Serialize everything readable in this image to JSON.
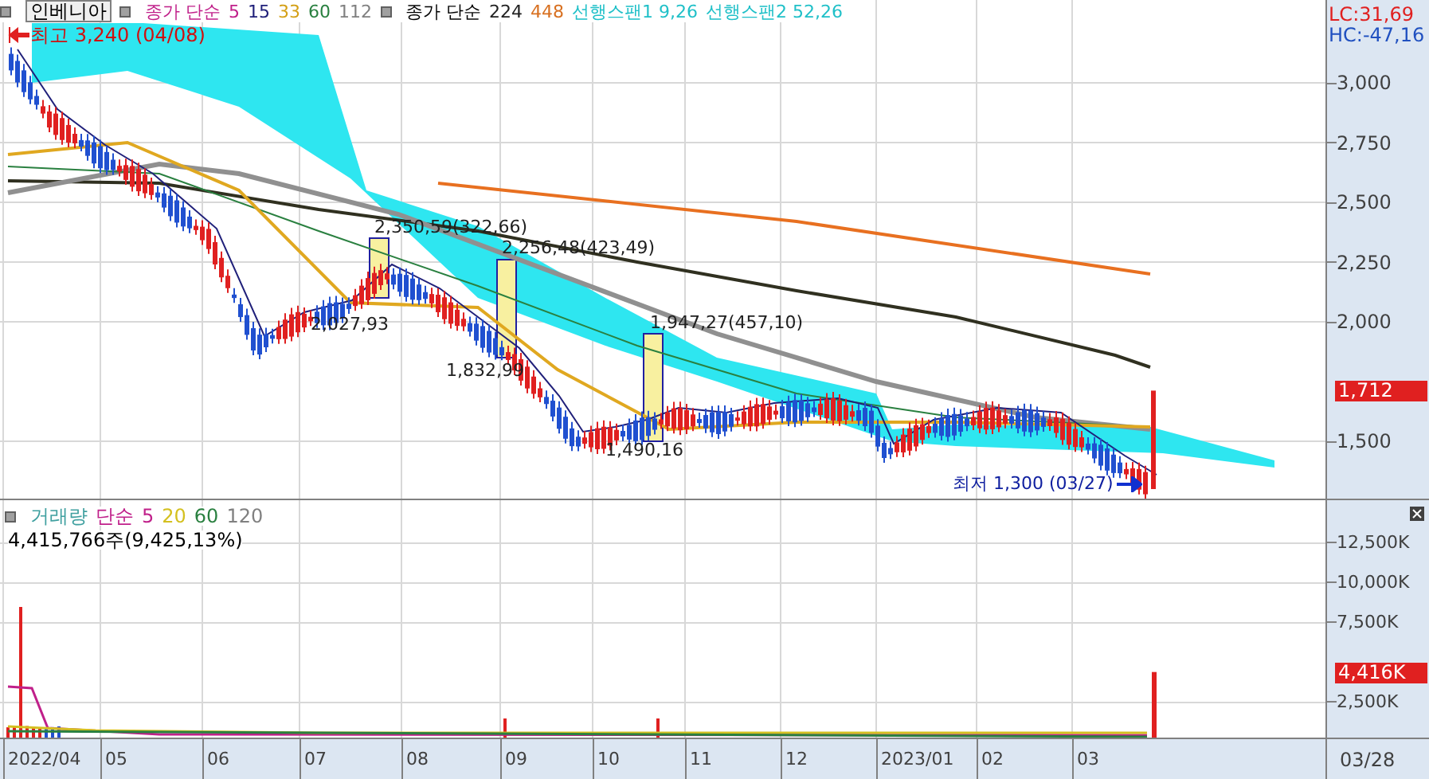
{
  "price_legend": {
    "stock_name": "인베니아",
    "ma_label": "종가 단순",
    "ma_periods": [
      {
        "label": "5",
        "color": "#c0208a"
      },
      {
        "label": "15",
        "color": "#20207a"
      },
      {
        "label": "33",
        "color": "#d4a017"
      },
      {
        "label": "60",
        "color": "#2a8040"
      },
      {
        "label": "112",
        "color": "#808080"
      }
    ],
    "ma2_label": "종가 단순",
    "ma2_periods": [
      {
        "label": "224",
        "color": "#202020"
      },
      {
        "label": "448",
        "color": "#d87020"
      }
    ],
    "spans": [
      {
        "label": "선행스팬1 9,26",
        "color": "#20c0c8"
      },
      {
        "label": "선행스팬2 52,26",
        "color": "#20c0c8"
      }
    ]
  },
  "price_high": "최고 3,240 (04/08)",
  "price_low": "최저 1,300 (03/27)",
  "annotations": [
    {
      "text": "2,350,59(322,66)"
    },
    {
      "text": "2,256,48(423,49)"
    },
    {
      "text": "2,027,93"
    },
    {
      "text": "1,947,27(457,10)"
    },
    {
      "text": "1,832,99"
    },
    {
      "text": "1,490,16"
    }
  ],
  "lc": "LC:31,69",
  "hc": "HC:-47,16",
  "price_axis": [
    "3,000",
    "2,750",
    "2,500",
    "2,250",
    "2,000",
    "1,500"
  ],
  "current_price": "1,712",
  "volume_legend": {
    "title": "거래량",
    "ma_label": "단순",
    "periods": [
      {
        "label": "5",
        "color": "#c0208a"
      },
      {
        "label": "20",
        "color": "#d4c020"
      },
      {
        "label": "60",
        "color": "#2a8040"
      },
      {
        "label": "120",
        "color": "#808080"
      }
    ]
  },
  "volume_reading": "4,415,766주(9,425,13%)",
  "volume_axis": [
    "12,500K",
    "10,000K",
    "7,500K",
    "2,500K"
  ],
  "current_volume": "4,416K",
  "date_axis": [
    "2022/04",
    "05",
    "06",
    "07",
    "08",
    "09",
    "10",
    "11",
    "12",
    "2023/01",
    "02",
    "03"
  ],
  "cursor_date": "03/28"
}
